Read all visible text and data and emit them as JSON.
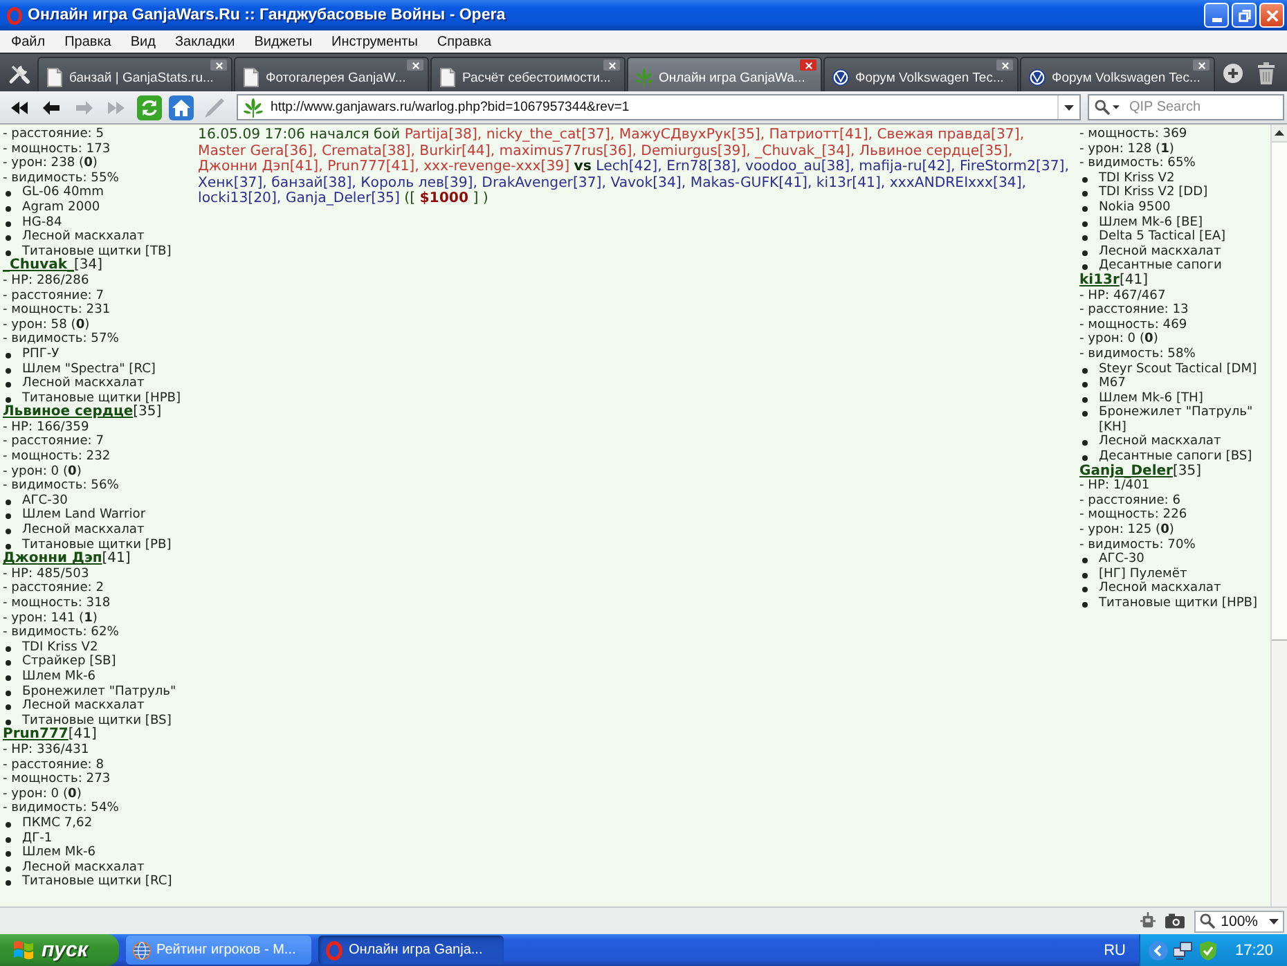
{
  "window": {
    "title": "Онлайн игра GanjaWars.Ru :: Ганджубасовые Войны - Opera"
  },
  "menu": [
    "Файл",
    "Правка",
    "Вид",
    "Закладки",
    "Виджеты",
    "Инструменты",
    "Справка"
  ],
  "tabs": [
    {
      "label": "банзай | GanjaStats.ru...",
      "kind": "page",
      "selected": false
    },
    {
      "label": "Фотогалерея GanjaW...",
      "kind": "page",
      "selected": false
    },
    {
      "label": "Расчёт себестоимости...",
      "kind": "page",
      "selected": false
    },
    {
      "label": "Онлайн игра GanjaWa...",
      "kind": "game",
      "selected": true
    },
    {
      "label": "Форум Volkswagen Tec...",
      "kind": "forum",
      "selected": false
    },
    {
      "label": "Форум Volkswagen Tec...",
      "kind": "forum",
      "selected": false
    }
  ],
  "toolbar": {
    "nav_buttons": [
      {
        "kind": "rewind",
        "disabled": false
      },
      {
        "kind": "back",
        "disabled": false
      },
      {
        "kind": "forward",
        "disabled": true
      },
      {
        "kind": "fast_forward",
        "disabled": true
      },
      {
        "kind": "reload",
        "disabled": false
      },
      {
        "kind": "home",
        "disabled": false
      },
      {
        "kind": "edit",
        "disabled": true
      }
    ],
    "address": "http://www.ganjawars.ru/warlog.php?bid=1067957344&rev=1",
    "search": {
      "placeholder": "QIP Search"
    }
  },
  "left_column": [
    {
      "stats": [
        "- расстояние: 5",
        "- мощность: 173",
        "- урон: 238 (**0**)",
        "- видимость: 55%"
      ],
      "items": [
        "GL-06 40mm",
        "Agram 2000",
        "HG-84",
        "Лесной маскхалат",
        "Титановые щитки [TB]"
      ]
    },
    {
      "name": "_Chuvak_",
      "level": "[34]",
      "stats": [
        "- HP: 286/286",
        "- расстояние: 7",
        "- мощность: 231",
        "- урон: 58 (**0**)",
        "- видимость: 57%"
      ],
      "items": [
        "РПГ-У",
        "Шлем \"Spectra\" [RC]",
        "Лесной маскхалат",
        "Титановые щитки [HPB]"
      ]
    },
    {
      "name": "Львиное сердце",
      "level": "[35]",
      "stats": [
        "- HP: 166/359",
        "- расстояние: 7",
        "- мощность: 232",
        "- урон: 0 (**0**)",
        "- видимость: 56%"
      ],
      "items": [
        "АГС-30",
        "Шлем Land Warrior",
        "Лесной маскхалат",
        "Титановые щитки [PB]"
      ]
    },
    {
      "name": "Джонни Дэп",
      "level": "[41]",
      "stats": [
        "- HP: 485/503",
        "- расстояние: 2",
        "- мощность: 318",
        "- урон: 141 (**1**)",
        "- видимость: 62%"
      ],
      "items": [
        "TDI Kriss V2",
        "Страйкер [SB]",
        "Шлем Mk-6",
        "Бронежилет \"Патруль\"",
        "Лесной маскхалат",
        "Титановые щитки [BS]"
      ]
    },
    {
      "name": "Prun777",
      "level": "[41]",
      "stats": [
        "- HP: 336/431",
        "- расстояние: 8",
        "- мощность: 273",
        "- урон: 0 (**0**)",
        "- видимость: 54%"
      ],
      "items": [
        "ПКМС 7,62",
        "ДГ-1",
        "Шлем Mk-6",
        "Лесной маскхалат",
        "Титановые щитки [RC]"
      ]
    }
  ],
  "battle": {
    "timestamp": "16.05.09 17:06",
    "event": "начался бой",
    "teams": [
      {
        "players": [
          "Partija[38],",
          "nicky_the_cat[37],",
          "МажуСДвухРук[35],",
          "Патриотт[41],",
          "Свежая правда[37],",
          "Master Gera[36],",
          "Cremata[38],",
          "Burkir[44],",
          "maximus77rus[36],",
          "Demiurgus[39],",
          "_Chuvak_[34],",
          "Львиное сердце[35],",
          "Джонни Дэп[41],",
          "Prun777[41],",
          "xxx-revenge-xxx[39]"
        ]
      },
      {
        "players": [
          "Lech[42],",
          "Ern78[38],",
          "voodoo_au[38],",
          "mafija-ru[42],",
          "FireStorm2[37],",
          "Хенк[37],",
          "банзай[38],",
          "Король лев[39],",
          "DrakAvenger[37],",
          "Vavok[34],",
          "Makas-GUFK[41],",
          "ki13r[41],",
          "xxxANDREIxxx[34],",
          "locki13[20],",
          "Ganja_Deler[35]"
        ]
      }
    ],
    "versus": "vs",
    "prize_open": "([",
    "prize": "$1000",
    "prize_close": "] )"
  },
  "right_column": [
    {
      "stats": [
        "- мощность: 369",
        "- урон: 128 (**1**)",
        "- видимость: 65%"
      ],
      "items": [
        "TDI Kriss V2",
        "TDI Kriss V2 [DD]",
        "Nokia 9500",
        "Шлем Mk-6 [BE]",
        "Delta 5 Tactical [EA]",
        "Лесной маскхалат",
        "Десантные сапоги"
      ]
    },
    {
      "name": "ki13r",
      "level": "[41]",
      "stats": [
        "- HP: 467/467",
        "- расстояние: 13",
        "- мощность: 469",
        "- урон: 0 (**0**)",
        "- видимость: 58%"
      ],
      "items": [
        "Steyr Scout Tactical [DM]",
        "M67",
        "Шлем Mk-6 [TH]",
        "Бронежилет \"Патруль\" [KH]",
        "Лесной маскхалат",
        "Десантные сапоги [BS]"
      ]
    },
    {
      "name": "Ganja_Deler",
      "level": "[35]",
      "stats": [
        "- HP: 1/401",
        "- расстояние: 6",
        "- мощность: 226",
        "- урон: 125 (**0**)",
        "- видимость: 70%"
      ],
      "items": [
        "АГС-30",
        "[НГ] Пулемёт",
        "Лесной маскхалат",
        "Титановые щитки [HPB]"
      ]
    }
  ],
  "status_bar": {
    "zoom": "100%"
  },
  "taskbar": {
    "start": "пуск",
    "tasks": [
      {
        "label": "Рейтинг игроков - М...",
        "kind": "web",
        "selected": false
      },
      {
        "label": "Онлайн игра Ganja...",
        "kind": "app",
        "selected": true
      }
    ],
    "language": "RU",
    "clock": "17:20"
  }
}
